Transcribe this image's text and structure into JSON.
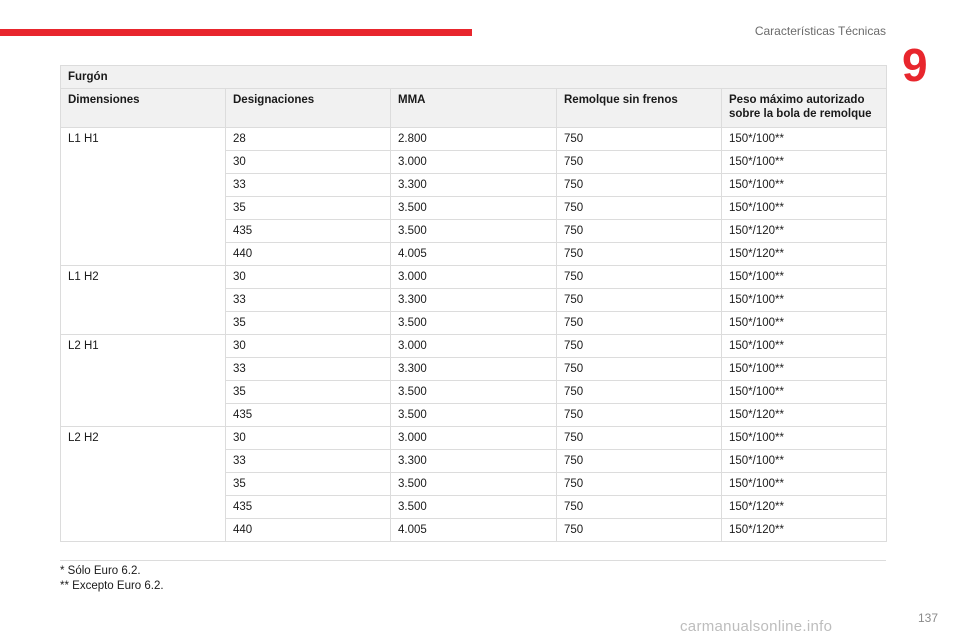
{
  "header": {
    "section_title": "Características Técnicas",
    "chapter_number": "9"
  },
  "table": {
    "title": "Furgón",
    "columns": [
      "Dimensiones",
      "Designaciones",
      "MMA",
      "Remolque sin frenos",
      "Peso máximo autorizado sobre la bola de remolque"
    ],
    "groups": [
      {
        "dimension": "L1 H1",
        "rows": [
          [
            "28",
            "2.800",
            "750",
            "150*/100**"
          ],
          [
            "30",
            "3.000",
            "750",
            "150*/100**"
          ],
          [
            "33",
            "3.300",
            "750",
            "150*/100**"
          ],
          [
            "35",
            "3.500",
            "750",
            "150*/100**"
          ],
          [
            "435",
            "3.500",
            "750",
            "150*/120**"
          ],
          [
            "440",
            "4.005",
            "750",
            "150*/120**"
          ]
        ]
      },
      {
        "dimension": "L1 H2",
        "rows": [
          [
            "30",
            "3.000",
            "750",
            "150*/100**"
          ],
          [
            "33",
            "3.300",
            "750",
            "150*/100**"
          ],
          [
            "35",
            "3.500",
            "750",
            "150*/100**"
          ]
        ]
      },
      {
        "dimension": "L2 H1",
        "rows": [
          [
            "30",
            "3.000",
            "750",
            "150*/100**"
          ],
          [
            "33",
            "3.300",
            "750",
            "150*/100**"
          ],
          [
            "35",
            "3.500",
            "750",
            "150*/100**"
          ],
          [
            "435",
            "3.500",
            "750",
            "150*/120**"
          ]
        ]
      },
      {
        "dimension": "L2 H2",
        "rows": [
          [
            "30",
            "3.000",
            "750",
            "150*/100**"
          ],
          [
            "33",
            "3.300",
            "750",
            "150*/100**"
          ],
          [
            "35",
            "3.500",
            "750",
            "150*/100**"
          ],
          [
            "435",
            "3.500",
            "750",
            "150*/120**"
          ],
          [
            "440",
            "4.005",
            "750",
            "150*/120**"
          ]
        ]
      }
    ]
  },
  "footnotes": [
    "*  Sólo Euro 6.2.",
    "** Excepto Euro 6.2."
  ],
  "page_number": "137",
  "watermark": "carmanualsonline.info",
  "colors": {
    "accent_red": "#e8262d",
    "header_fill": "#f1f1f1",
    "grid_line": "#dcdcdc"
  }
}
